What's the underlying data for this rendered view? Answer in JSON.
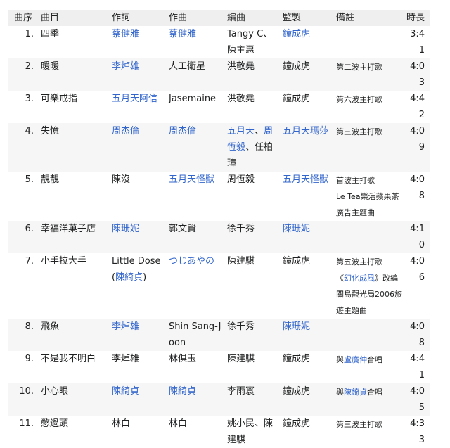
{
  "headers": {
    "no": "曲序",
    "title": "曲目",
    "lyricist": "作詞",
    "composer": "作曲",
    "arranger": "編曲",
    "producer": "監製",
    "notes": "備註",
    "length": "時長"
  },
  "link_color": "#3366cc",
  "tracks": [
    {
      "no": "1.",
      "title": "四季",
      "lyricist": [
        {
          "text": "蔡健雅",
          "link": true
        }
      ],
      "composer": [
        {
          "text": "蔡健雅",
          "link": true
        }
      ],
      "arranger": [
        {
          "text": "Tangy C、陳主惠",
          "link": false
        }
      ],
      "producer": [
        {
          "text": "鐘成虎",
          "link": true
        }
      ],
      "notes": [],
      "length": "3:41"
    },
    {
      "no": "2.",
      "title": "暖暖",
      "lyricist": [
        {
          "text": "李焯雄",
          "link": true
        }
      ],
      "composer": [
        {
          "text": "人工衛星",
          "link": false
        }
      ],
      "arranger": [
        {
          "text": "洪敬堯",
          "link": false
        }
      ],
      "producer": [
        {
          "text": "鐘成虎",
          "link": false
        }
      ],
      "notes": [
        [
          {
            "text": "第二波主打歌",
            "link": false
          }
        ]
      ],
      "length": "4:03"
    },
    {
      "no": "3.",
      "title": "可樂戒指",
      "lyricist": [
        {
          "text": "五月天阿信",
          "link": true
        }
      ],
      "composer": [
        {
          "text": "Jasemaine",
          "link": false
        }
      ],
      "arranger": [
        {
          "text": "洪敬堯",
          "link": false
        }
      ],
      "producer": [
        {
          "text": "鐘成虎",
          "link": false
        }
      ],
      "notes": [
        [
          {
            "text": "第六波主打歌",
            "link": false
          }
        ]
      ],
      "length": "4:42"
    },
    {
      "no": "4.",
      "title": "失憶",
      "lyricist": [
        {
          "text": "周杰倫",
          "link": true
        }
      ],
      "composer": [
        {
          "text": "周杰倫",
          "link": true
        }
      ],
      "arranger": [
        {
          "text": "五月天",
          "link": true
        },
        {
          "text": "、",
          "link": false
        },
        {
          "text": "周恆毅",
          "link": true
        },
        {
          "text": "、",
          "link": false
        },
        {
          "text": "任柏璋",
          "link": false
        }
      ],
      "producer": [
        {
          "text": "五月天瑪莎",
          "link": true
        }
      ],
      "notes": [
        [
          {
            "text": "第三波主打歌",
            "link": false
          }
        ]
      ],
      "length": "4:09"
    },
    {
      "no": "5.",
      "title": "靚靚",
      "lyricist": [
        {
          "text": "陳沒",
          "link": false
        }
      ],
      "composer": [
        {
          "text": "五月天怪獸",
          "link": true
        }
      ],
      "arranger": [
        {
          "text": "周恆毅",
          "link": false
        }
      ],
      "producer": [
        {
          "text": "五月天怪獸",
          "link": true
        }
      ],
      "notes": [
        [
          {
            "text": "首波主打歌",
            "link": false
          }
        ],
        [
          {
            "text": "Le Tea樂活蘋果茶廣告主題曲",
            "link": false
          }
        ]
      ],
      "length": "4:08"
    },
    {
      "no": "6.",
      "title": "幸福洋菓子店",
      "lyricist": [
        {
          "text": "陳珊妮",
          "link": true
        }
      ],
      "composer": [
        {
          "text": "郭文賢",
          "link": false
        }
      ],
      "arranger": [
        {
          "text": "徐千秀",
          "link": false
        }
      ],
      "producer": [
        {
          "text": "陳珊妮",
          "link": true
        }
      ],
      "notes": [],
      "length": "4:10"
    },
    {
      "no": "7.",
      "title": "小手拉大手",
      "lyricist": [
        {
          "text": "Little Dose(",
          "link": false
        },
        {
          "text": "陳綺貞",
          "link": true
        },
        {
          "text": ")",
          "link": false
        }
      ],
      "composer": [
        {
          "text": "つじあやの",
          "link": true
        }
      ],
      "arranger": [
        {
          "text": "陳建騏",
          "link": false
        }
      ],
      "producer": [
        {
          "text": "鐘成虎",
          "link": false
        }
      ],
      "notes": [
        [
          {
            "text": "第五波主打歌",
            "link": false
          }
        ],
        [
          {
            "text": "《",
            "link": false
          },
          {
            "text": "幻化成風",
            "link": true
          },
          {
            "text": "》改編",
            "link": false
          }
        ],
        [
          {
            "text": "關島觀光局2006旅遊主題曲",
            "link": false
          }
        ]
      ],
      "length": "4:06"
    },
    {
      "no": "8.",
      "title": "飛魚",
      "lyricist": [
        {
          "text": "李焯雄",
          "link": true
        }
      ],
      "composer": [
        {
          "text": "Shin Sang-Joon",
          "link": false
        }
      ],
      "arranger": [
        {
          "text": "徐千秀",
          "link": false
        }
      ],
      "producer": [
        {
          "text": "陳珊妮",
          "link": true
        }
      ],
      "notes": [],
      "length": "4:08"
    },
    {
      "no": "9.",
      "title": "不是我不明白",
      "lyricist": [
        {
          "text": "李焯雄",
          "link": false
        }
      ],
      "composer": [
        {
          "text": "林俱玉",
          "link": false
        }
      ],
      "arranger": [
        {
          "text": "陳建騏",
          "link": false
        }
      ],
      "producer": [
        {
          "text": "鐘成虎",
          "link": false
        }
      ],
      "notes": [
        [
          {
            "text": "與",
            "link": false
          },
          {
            "text": "盧廣仲",
            "link": true
          },
          {
            "text": "合唱",
            "link": false
          }
        ]
      ],
      "length": "4:41"
    },
    {
      "no": "10.",
      "title": "小心眼",
      "lyricist": [
        {
          "text": "陳綺貞",
          "link": true
        }
      ],
      "composer": [
        {
          "text": "陳綺貞",
          "link": true
        }
      ],
      "arranger": [
        {
          "text": "李雨寰",
          "link": false
        }
      ],
      "producer": [
        {
          "text": "鐘成虎",
          "link": false
        }
      ],
      "notes": [
        [
          {
            "text": "與",
            "link": false
          },
          {
            "text": "陳綺貞",
            "link": true
          },
          {
            "text": "合唱",
            "link": false
          }
        ]
      ],
      "length": "4:05"
    },
    {
      "no": "11.",
      "title": "憋過頭",
      "lyricist": [
        {
          "text": "林白",
          "link": false
        }
      ],
      "composer": [
        {
          "text": "林白",
          "link": false
        }
      ],
      "arranger": [
        {
          "text": "姚小民、陳建騏",
          "link": false
        }
      ],
      "producer": [
        {
          "text": "鐘成虎",
          "link": false
        }
      ],
      "notes": [
        [
          {
            "text": "第三波主打歌",
            "link": false
          }
        ]
      ],
      "length": "4:33"
    }
  ]
}
